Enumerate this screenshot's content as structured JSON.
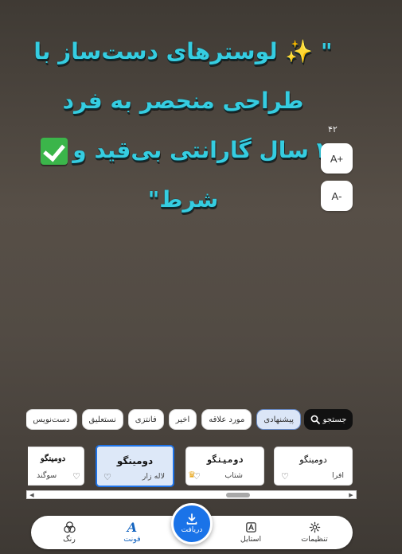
{
  "headline": {
    "line1_text": "\" ✨ لوسترهای دست‌ساز با",
    "line2_text": "طراحی منحصر به فرد",
    "line3_text": "۲ سال گارانتی بی‌قید و",
    "line4_text": "شرط\""
  },
  "size": {
    "count": "۴۲",
    "increase_label": "A+",
    "decrease_label": "A-"
  },
  "filters": {
    "search_label": "جستجو",
    "chips": [
      {
        "label": "پیشنهادی",
        "active": true
      },
      {
        "label": "مورد علاقه",
        "active": false
      },
      {
        "label": "اخیر",
        "active": false
      },
      {
        "label": "فانتزی",
        "active": false
      },
      {
        "label": "نستعلیق",
        "active": false
      },
      {
        "label": "دست‌نویس",
        "active": false
      }
    ]
  },
  "fonts": [
    {
      "sample": "دومینگو",
      "name": "افرا",
      "selected": false
    },
    {
      "sample": "دومینگو",
      "name": "شتاب",
      "selected": false,
      "premium": true
    },
    {
      "sample": "دومینگو",
      "name": "لاله زار",
      "selected": true
    },
    {
      "sample": "دومینگو",
      "name": "سوگند",
      "selected": false
    }
  ],
  "nav": {
    "settings_label": "تنظیمات",
    "style_label": "استایل",
    "download_label": "دریافت",
    "font_label": "فونت",
    "color_label": "رنگ"
  },
  "colors": {
    "headline_text": "#35cde1",
    "accent": "#1a73e8",
    "selected_card_bg": "#dde8f8",
    "premium_crown": "#e8a10a"
  },
  "icons": [
    "sparkles-icon",
    "check-box-icon",
    "search-icon",
    "heart-icon",
    "crown-icon",
    "gear-icon",
    "style-icon",
    "download-icon",
    "font-icon",
    "palette-icon"
  ]
}
